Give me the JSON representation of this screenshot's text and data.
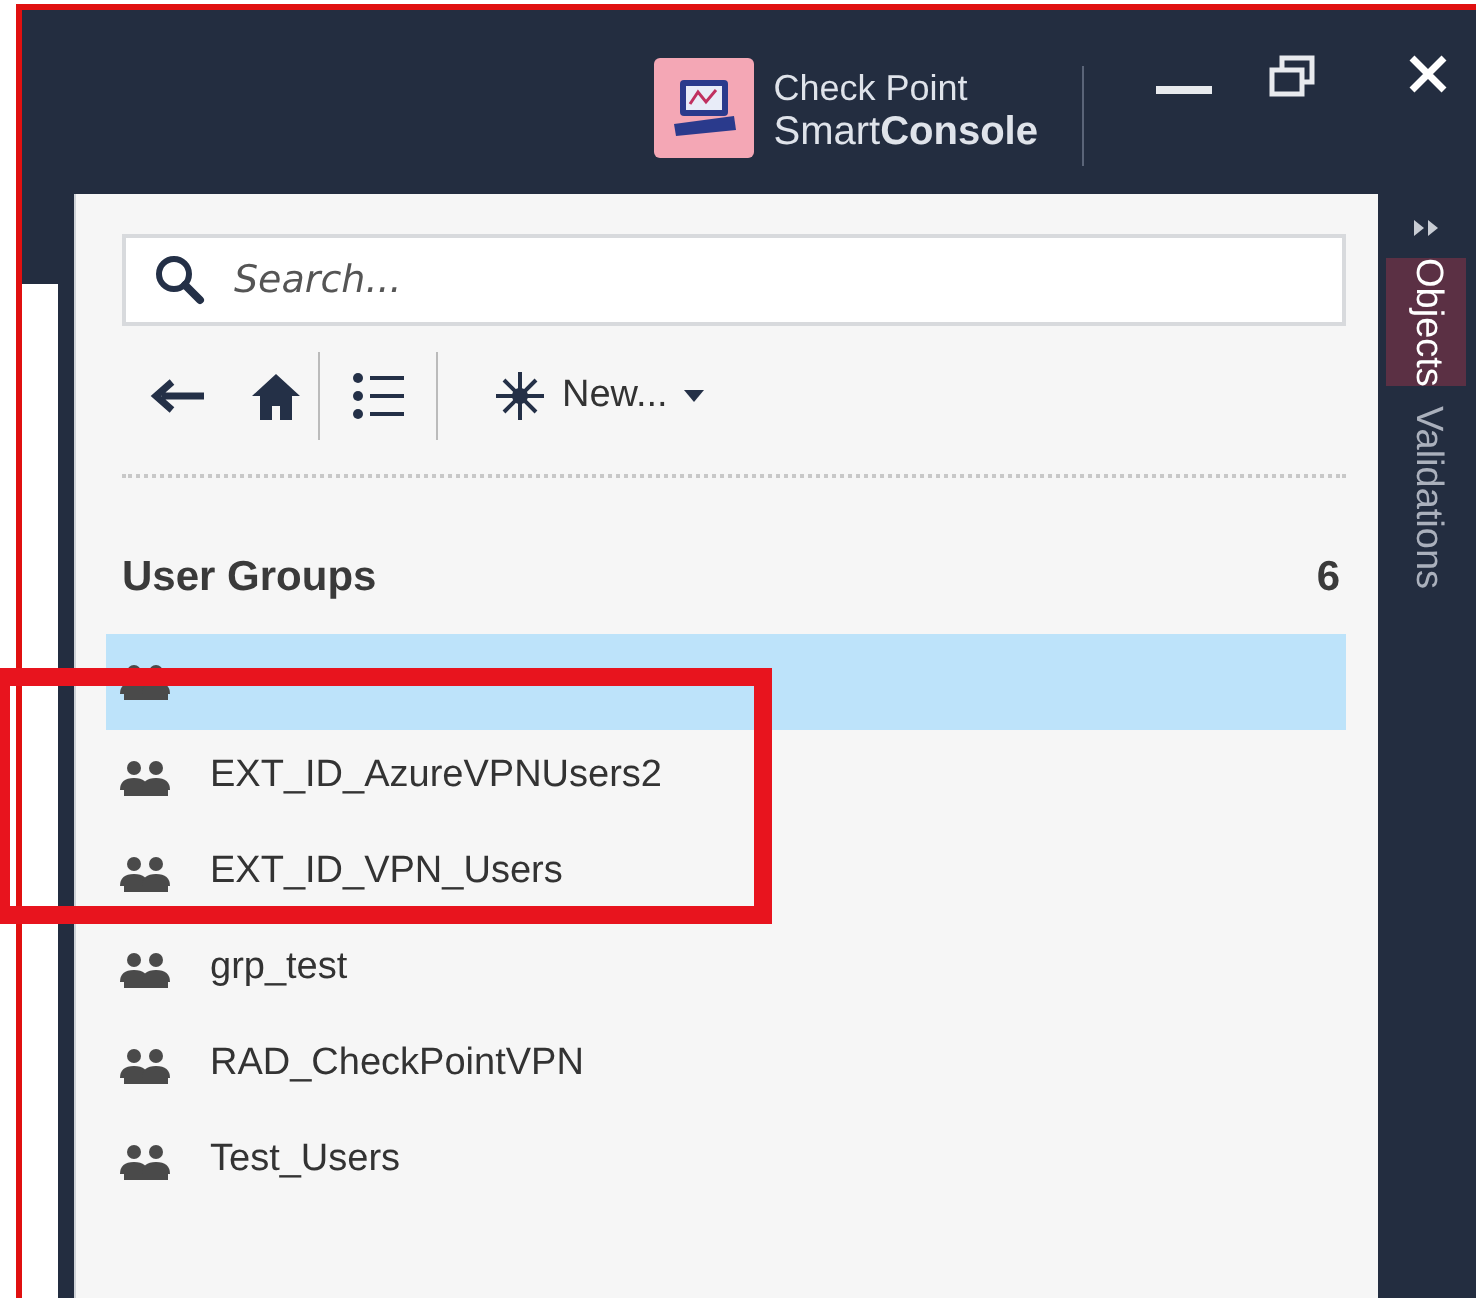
{
  "window": {
    "brand_top": "Check Point",
    "brand_bottom": "Smart**Console**"
  },
  "search": {
    "placeholder": "Search..."
  },
  "toolbar": {
    "new_label": "New..."
  },
  "section": {
    "title": "User Groups",
    "count": "6"
  },
  "groups": [
    {
      "selected": true
    },
    {
      "label": "EXT_ID_AzureVPNUsers2",
      "selected": false
    },
    {
      "label": "EXT_ID_VPN_Users",
      "selected": false
    },
    {
      "label": "grp_test",
      "selected": false
    },
    {
      "label": "RAD_CheckPointVPN",
      "selected": false
    },
    {
      "label": "Test_Users",
      "selected": false
    }
  ],
  "side_tabs": [
    {
      "label": "Objects",
      "selected": true
    },
    {
      "label": "Validations",
      "selected": false
    }
  ]
}
